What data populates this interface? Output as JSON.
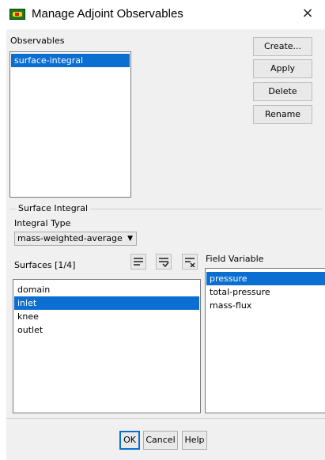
{
  "window": {
    "title": "Manage Adjoint Observables",
    "close_glyph": "×",
    "icon": "fluent-app-icon"
  },
  "observables": {
    "label": "Observables",
    "items": [
      "surface-integral"
    ],
    "selected": "surface-integral"
  },
  "actions": {
    "create": "Create...",
    "apply": "Apply",
    "delete": "Delete",
    "rename": "Rename"
  },
  "surface_integral": {
    "group_label": "Surface Integral",
    "integral_type_label": "Integral Type",
    "integral_type_value": "mass-weighted-average",
    "surfaces_label": "Surfaces [1/4]",
    "surfaces": [
      "domain",
      "inlet",
      "knee",
      "outlet"
    ],
    "selected_surface": "inlet",
    "field_variable_label": "Field Variable",
    "field_variables": [
      "pressure",
      "total-pressure",
      "mass-flux"
    ],
    "selected_field_variable": "pressure",
    "surface_tools": [
      "select-all-icon",
      "deselect-all-icon",
      "clear-selection-icon"
    ]
  },
  "footer": {
    "ok": "OK",
    "cancel": "Cancel",
    "help": "Help"
  },
  "colors": {
    "selection": "#0b6fd2",
    "dialog_bg": "#f0f0f0"
  }
}
